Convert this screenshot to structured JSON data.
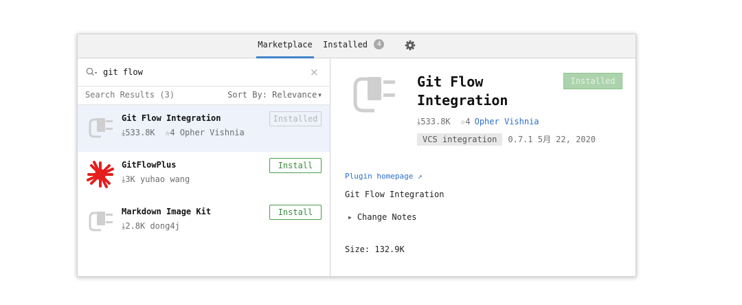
{
  "tabs": {
    "marketplace": "Marketplace",
    "installed": "Installed",
    "installed_count": "4"
  },
  "search": {
    "value": "git flow",
    "placeholder": ""
  },
  "results": {
    "count_label": "Search Results (3)",
    "sort_label": "Sort By: Relevance"
  },
  "plugins": [
    {
      "name": "Git Flow Integration",
      "downloads": "533.8K",
      "rating": "4",
      "vendor": "Opher Vishnia",
      "button": "Installed",
      "icon": "plug-icon"
    },
    {
      "name": "GitFlowPlus",
      "downloads": "3K",
      "vendor": "yuhao wang",
      "button": "Install",
      "icon": "red-splat-logo"
    },
    {
      "name": "Markdown Image Kit",
      "downloads": "2.8K",
      "vendor": "dong4j",
      "button": "Install",
      "icon": "plug-icon"
    }
  ],
  "detail": {
    "title": "Git Flow Integration",
    "installed_button": "Installed",
    "downloads": "533.8K",
    "rating": "4",
    "vendor": "Opher Vishnia",
    "category": "VCS integration",
    "version": "0.7.1",
    "date": "5月 22, 2020",
    "homepage": "Plugin homepage ↗",
    "description": "Git Flow Integration",
    "change_notes": "Change Notes",
    "size": "Size: 132.9K"
  },
  "colors": {
    "accent": "#4083c9",
    "install_green": "#3d8b3d",
    "link": "#2a6fc9",
    "selected_row": "#edf2fb"
  }
}
